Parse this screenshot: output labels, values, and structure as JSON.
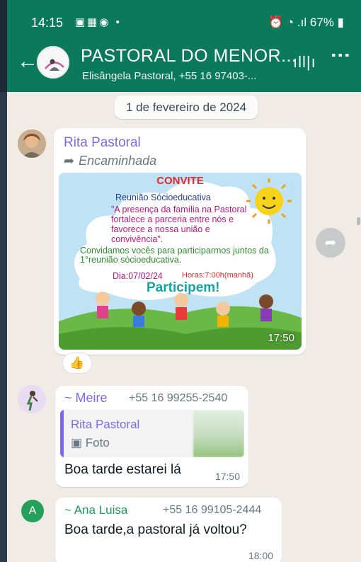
{
  "status_bar": {
    "time": "14:15",
    "battery": "67%"
  },
  "header": {
    "back_icon": "←",
    "title": "PASTORAL DO MENOR...",
    "subtitle": "Elisângela Pastoral, +55 16 97403-...",
    "voice_icon": "ıll|ı",
    "menu_icon": "⋮"
  },
  "date_chip": "1 de fevereiro de 2024",
  "messages": [
    {
      "sender": "Rita Pastoral",
      "forwarded_label": "Encaminhada",
      "image": {
        "title": "CONVITE",
        "line1": "Reunião Sócioeducativa",
        "line2": "\"A presença da família na Pastoral fortalece a parceria entre nós e favorece a nossa união e convivência\".",
        "line3": "Convidamos vocês para participarmos juntos da 1°reunião sócioeducativa.",
        "dia": "Dia:07/02/24",
        "hora": "Horas:7:00h(manhã)",
        "participem": "Participem!"
      },
      "time": "17:50",
      "reaction": "👍"
    },
    {
      "sender": "~ Meire",
      "phone": "+55 16 99255-2540",
      "quote": {
        "name": "Rita Pastoral",
        "type": "Foto"
      },
      "text": "Boa tarde estarei lá",
      "time": "17:50"
    },
    {
      "sender": "~ Ana Luisa",
      "phone": "+55 16 99105-2444",
      "text": "Boa tarde,a pastoral já voltou?",
      "time": "18:00",
      "avatar_letter": "A"
    }
  ],
  "colors": {
    "header": "#0b7a5a",
    "sender_purple": "#7d6ae8",
    "sender_green": "#1a9a5c",
    "chat_bg": "#f0ebe4"
  }
}
